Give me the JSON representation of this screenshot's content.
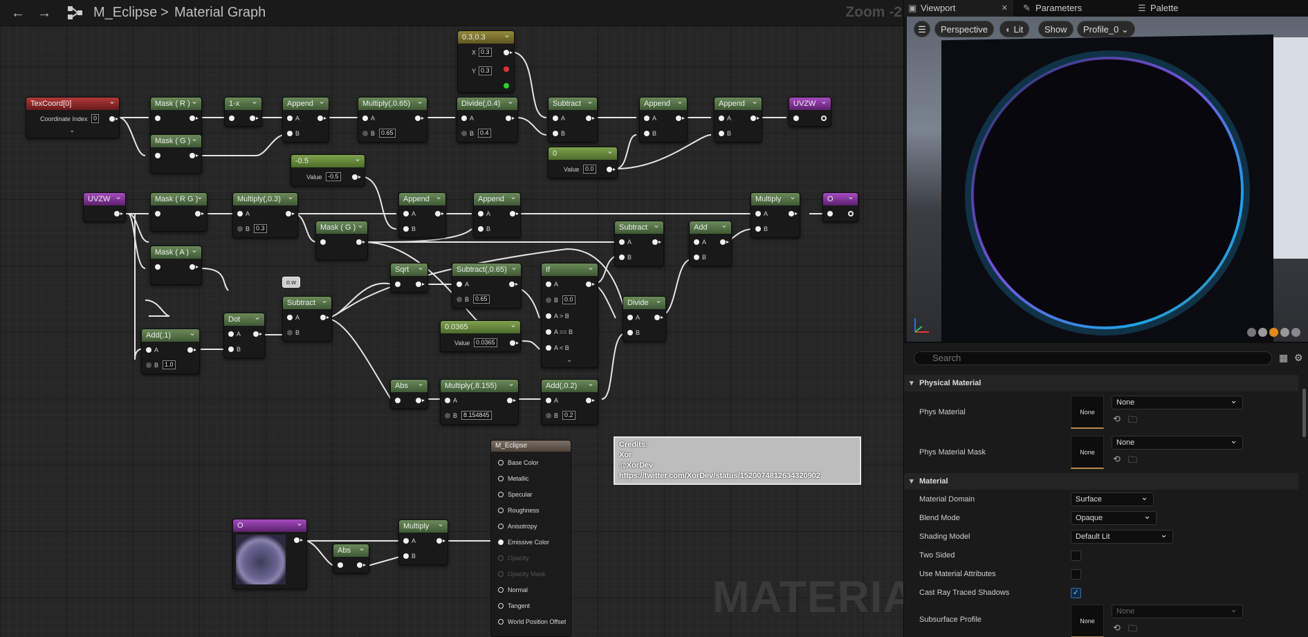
{
  "topbar": {
    "back": "←",
    "forward": "→",
    "asset": "M_Eclipse",
    "separator": ">",
    "graph": "Material Graph",
    "zoom": "Zoom -2"
  },
  "watermark": "MATERIAL",
  "nodes": {
    "texcoord": {
      "title": "TexCoord[0]",
      "coord_label": "Coordinate Index",
      "coord_value": "0"
    },
    "mask_r": {
      "title": "Mask ( R )"
    },
    "one_minus": {
      "title": "1-x"
    },
    "append1": {
      "title": "Append",
      "a": "A",
      "b": "B"
    },
    "multiply065": {
      "title": "Multiply(,0.65)",
      "a": "A",
      "b": "B",
      "b_value": "0.65"
    },
    "divide04": {
      "title": "Divide(,0.4)",
      "a": "A",
      "b": "B",
      "b_value": "0.4"
    },
    "vec033": {
      "title": "0.3,0.3",
      "x": "X",
      "x_value": "0.3",
      "y": "Y",
      "y_value": "0.3"
    },
    "subtract_top": {
      "title": "Subtract",
      "a": "A",
      "b": "B"
    },
    "append2": {
      "title": "Append",
      "a": "A",
      "b": "B"
    },
    "append3": {
      "title": "Append",
      "a": "A",
      "b": "B"
    },
    "uvzw_out": {
      "title": "UVZW"
    },
    "mask_g_top": {
      "title": "Mask ( G )"
    },
    "const0": {
      "title": "0",
      "value_label": "Value",
      "value": "0.0"
    },
    "minus05": {
      "title": "-0.5",
      "value_label": "Value",
      "value": "-0.5"
    },
    "uvzw_in": {
      "title": "UVZW"
    },
    "mask_rg": {
      "title": "Mask ( R G )"
    },
    "multiply03": {
      "title": "Multiply(,0.3)",
      "a": "A",
      "b": "B",
      "b_value": "0.3"
    },
    "mask_g_mid": {
      "title": "Mask ( G )"
    },
    "append4": {
      "title": "Append",
      "a": "A",
      "b": "B"
    },
    "append5": {
      "title": "Append",
      "a": "A",
      "b": "B"
    },
    "multiply_out": {
      "title": "Multiply",
      "a": "A",
      "b": "B"
    },
    "o_out": {
      "title": "O"
    },
    "subtract_mid": {
      "title": "Subtract",
      "a": "A",
      "b": "B"
    },
    "add_mid": {
      "title": "Add",
      "a": "A",
      "b": "B"
    },
    "mask_a": {
      "title": "Mask ( A )"
    },
    "ow_bubble": "o.w",
    "subtract_center": {
      "title": "Subtract",
      "a": "A",
      "b": "B"
    },
    "sqrt": {
      "title": "Sqrt"
    },
    "subtract065": {
      "title": "Subtract(,0.65)",
      "a": "A",
      "b": "B",
      "b_value": "0.65"
    },
    "if": {
      "title": "If",
      "a": "A",
      "b": "B",
      "b_value": "0.0",
      "agb": "A > B",
      "aeb": "A == B",
      "alb": "A < B"
    },
    "divide": {
      "title": "Divide",
      "a": "A",
      "b": "B"
    },
    "const0365": {
      "title": "0.0365",
      "value_label": "Value",
      "value": "0.0365"
    },
    "dot": {
      "title": "Dot",
      "a": "A",
      "b": "B"
    },
    "add1": {
      "title": "Add(,1)",
      "a": "A",
      "b": "B",
      "b_value": "1.0"
    },
    "abs_mid": {
      "title": "Abs"
    },
    "multiply8155": {
      "title": "Multiply(,8.155)",
      "a": "A",
      "b": "B",
      "b_value": "8.154845"
    },
    "add02": {
      "title": "Add(,0.2)",
      "a": "A",
      "b": "B",
      "b_value": "0.2"
    },
    "o_preview": {
      "title": "O"
    },
    "abs_bottom": {
      "title": "Abs"
    },
    "multiply_bottom": {
      "title": "Multiply",
      "a": "A",
      "b": "B"
    }
  },
  "result_node": {
    "title": "M_Eclipse",
    "pins": [
      "Base Color",
      "Metallic",
      "Specular",
      "Roughness",
      "Anisotropy",
      "Emissive Color",
      "Opacity",
      "Opacity Mask",
      "Normal",
      "Tangent",
      "World Position Offset"
    ]
  },
  "credits": {
    "line1": "Credits:",
    "line2": "Xor",
    "line3": "@XorDev",
    "line4": "https://twitter.com/XorDev/status/1520074812634320902"
  },
  "tabs": {
    "viewport": "Viewport",
    "close": "✕",
    "parameters": "Parameters",
    "palette": "Palette"
  },
  "viewport": {
    "perspective": "Perspective",
    "lit": "Lit",
    "show": "Show",
    "profile": "Profile_0"
  },
  "details": {
    "search_placeholder": "Search",
    "sections": {
      "physical": "Physical Material",
      "material": "Material"
    },
    "phys_material": {
      "label": "Phys Material",
      "thumb": "None",
      "value": "None"
    },
    "phys_material_mask": {
      "label": "Phys Material Mask",
      "thumb": "None",
      "value": "None"
    },
    "material_domain": {
      "label": "Material Domain",
      "value": "Surface"
    },
    "blend_mode": {
      "label": "Blend Mode",
      "value": "Opaque"
    },
    "shading_model": {
      "label": "Shading Model",
      "value": "Default Lit"
    },
    "two_sided": {
      "label": "Two Sided",
      "checked": false
    },
    "use_material_attributes": {
      "label": "Use Material Attributes",
      "checked": false
    },
    "cast_ray_traced_shadows": {
      "label": "Cast Ray Traced Shadows",
      "checked": true
    },
    "subsurface_profile": {
      "label": "Subsurface Profile",
      "thumb": "None",
      "value": "None"
    }
  },
  "colors": {
    "accent": "#2f6fb0",
    "eclipse_ring": "#1ea4e6",
    "eclipse_purple": "#8a3fd6"
  }
}
